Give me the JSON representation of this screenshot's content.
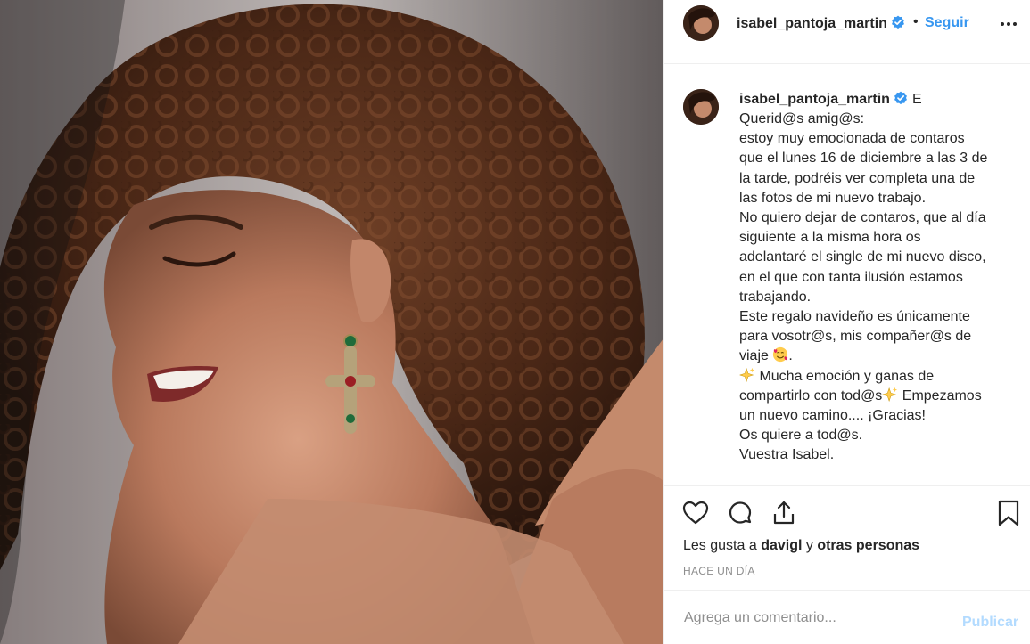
{
  "post": {
    "username": "isabel_pantoja_martin",
    "verified_icon": "verified-badge-icon",
    "follow_separator": "•",
    "follow_label": "Seguir",
    "caption": {
      "username": "isabel_pantoja_martin",
      "extra": "E",
      "lines": [
        "Querid@s amig@s:",
        "estoy muy emocionada de contaros",
        "que el lunes 16 de diciembre a las 3 de",
        "la tarde, podréis ver completa una de",
        "las fotos de mi nuevo trabajo.",
        "No quiero dejar de contaros, que al día",
        "siguiente a la misma hora os",
        "adelantaré el single de mi nuevo disco,",
        "en el que con tanta ilusión estamos",
        "trabajando.",
        "Este regalo navideño es únicamente",
        "para vosotr@s, mis compañer@s de"
      ],
      "line_viaje": "viaje",
      "line_mucha": "Mucha emoción y ganas de",
      "line_comp": "compartirlo con tod@s",
      "line_emp": "Empezamos",
      "lines_end": [
        "un nuevo camino.... ¡Gracias!",
        "Os quiere a tod@s.",
        "Vuestra Isabel."
      ]
    },
    "likes": {
      "prefix": "Les gusta a",
      "user": "davigl",
      "joiner": "y",
      "others": "otras personas"
    },
    "timestamp": "HACE UN DÍA",
    "comment": {
      "placeholder": "Agrega un comentario...",
      "publish_label": "Publicar"
    },
    "icons": {
      "like": "heart-icon",
      "comment": "comment-bubble-icon",
      "share": "share-icon",
      "save": "bookmark-icon",
      "more": "more-options-icon"
    },
    "colors": {
      "link": "#3897f0",
      "publish_disabled": "#b3dbff",
      "muted": "#8e8e8e",
      "text": "#262626"
    }
  }
}
